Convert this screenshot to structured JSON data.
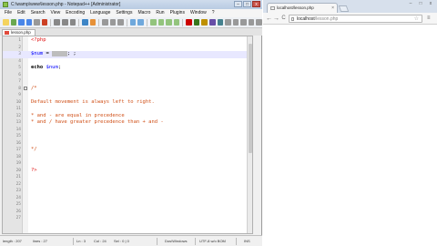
{
  "npp": {
    "title": "C:\\wamp\\www\\lesson.php - Notepad++ [Administrator]",
    "controls": {
      "min": "–",
      "max": "□",
      "close": "x"
    },
    "menu": [
      "File",
      "Edit",
      "Search",
      "View",
      "Encoding",
      "Language",
      "Settings",
      "Macro",
      "Run",
      "Plugins",
      "Window",
      "?"
    ],
    "tab": "lesson.php",
    "lines": [
      {
        "n": "1",
        "html": "<span class=\"c-tag\">&lt;?php</span>"
      },
      {
        "n": "2",
        "html": ""
      },
      {
        "n": "3",
        "html": "<span class=\"c-var\">$num</span> = <span class=\"c-str\">     </span>; ;",
        "current": true
      },
      {
        "n": "4",
        "html": ""
      },
      {
        "n": "5",
        "html": "<span class=\"c-kw\">echo</span> <span class=\"c-var\">$num</span>;"
      },
      {
        "n": "6",
        "html": ""
      },
      {
        "n": "7",
        "html": ""
      },
      {
        "n": "8",
        "html": "<span class=\"c-cmt\">/*</span>",
        "fold": true
      },
      {
        "n": "9",
        "html": ""
      },
      {
        "n": "10",
        "html": "<span class=\"c-cmt\">Default movement is always left to right.</span>"
      },
      {
        "n": "11",
        "html": ""
      },
      {
        "n": "12",
        "html": "<span class=\"c-cmt\">* and - are equal in precedence</span>"
      },
      {
        "n": "13",
        "html": "<span class=\"c-cmt\">* and / have greater precedence than + and -</span>"
      },
      {
        "n": "14",
        "html": ""
      },
      {
        "n": "15",
        "html": ""
      },
      {
        "n": "16",
        "html": ""
      },
      {
        "n": "17",
        "html": "<span class=\"c-cmt\">*/</span>"
      },
      {
        "n": "18",
        "html": ""
      },
      {
        "n": "19",
        "html": ""
      },
      {
        "n": "20",
        "html": "<span class=\"c-tag\">?&gt;</span>"
      },
      {
        "n": "21",
        "html": ""
      },
      {
        "n": "22",
        "html": ""
      },
      {
        "n": "23",
        "html": ""
      },
      {
        "n": "24",
        "html": ""
      },
      {
        "n": "25",
        "html": ""
      },
      {
        "n": "26",
        "html": ""
      },
      {
        "n": "27",
        "html": ""
      }
    ],
    "status": {
      "length": "length : 207",
      "lines": "lines : 27",
      "ln": "Ln : 3",
      "col": "Col : 24",
      "sel": "Sel : 0 | 0",
      "eol": "Dos\\Windows",
      "encoding": "UTF-8 w/o BOM",
      "mode": "INS"
    }
  },
  "chrome": {
    "tab_title": "localhost/lesson.php",
    "tab_close": "×",
    "controls": {
      "min": "–",
      "max": "□",
      "close": "x"
    },
    "back": "←",
    "forward": "→",
    "reload": "C",
    "url_host": "localhost",
    "url_path": "/lesson.php",
    "star": "☆",
    "wrench": "≡"
  },
  "colors": {
    "comment": "#d05018",
    "variable": "#0000ff",
    "php_tag": "#e01010",
    "current_line": "#e8e8ff"
  }
}
